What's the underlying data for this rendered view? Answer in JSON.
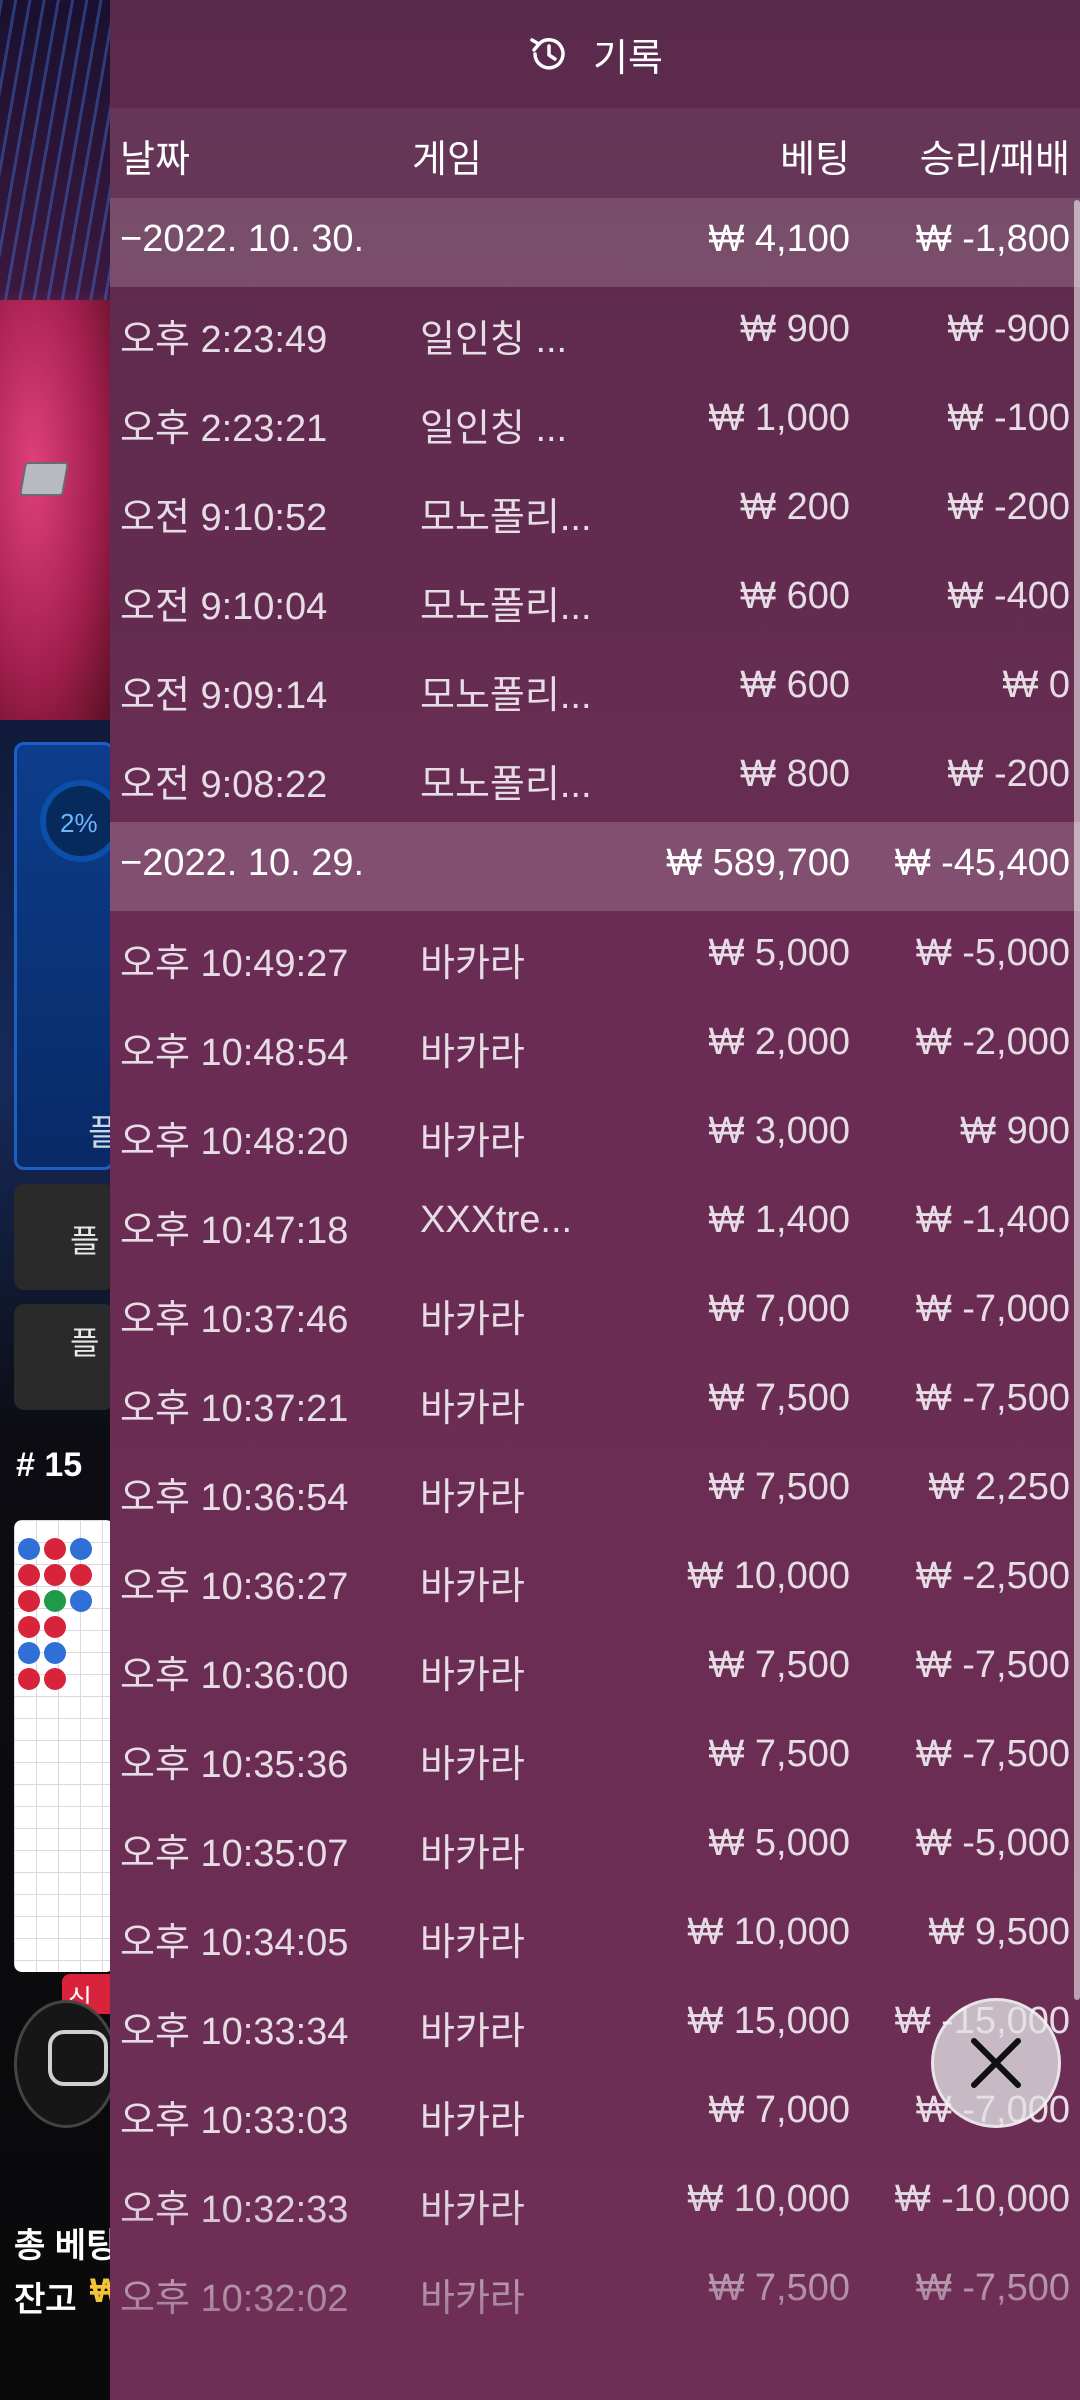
{
  "header": {
    "title": "기록",
    "icon": "history-clock-icon"
  },
  "columns": {
    "date": "날짜",
    "game": "게임",
    "bet": "베팅",
    "result": "승리/패배"
  },
  "groups": [
    {
      "date": "−2022. 10. 30.",
      "total_bet": "₩ 4,100",
      "total_result": "₩ -1,800",
      "rows": [
        {
          "time": "오후 2:23:49",
          "game": "일인칭 ...",
          "bet": "₩ 900",
          "result": "₩ -900"
        },
        {
          "time": "오후 2:23:21",
          "game": "일인칭 ...",
          "bet": "₩ 1,000",
          "result": "₩ -100"
        },
        {
          "time": "오전 9:10:52",
          "game": "모노폴리...",
          "bet": "₩ 200",
          "result": "₩ -200"
        },
        {
          "time": "오전 9:10:04",
          "game": "모노폴리...",
          "bet": "₩ 600",
          "result": "₩ -400"
        },
        {
          "time": "오전 9:09:14",
          "game": "모노폴리...",
          "bet": "₩ 600",
          "result": "₩ 0"
        },
        {
          "time": "오전 9:08:22",
          "game": "모노폴리...",
          "bet": "₩ 800",
          "result": "₩ -200"
        }
      ]
    },
    {
      "date": "−2022. 10. 29.",
      "total_bet": "₩ 589,700",
      "total_result": "₩ -45,400",
      "rows": [
        {
          "time": "오후 10:49:27",
          "game": "바카라",
          "bet": "₩ 5,000",
          "result": "₩ -5,000"
        },
        {
          "time": "오후 10:48:54",
          "game": "바카라",
          "bet": "₩ 2,000",
          "result": "₩ -2,000"
        },
        {
          "time": "오후 10:48:20",
          "game": "바카라",
          "bet": "₩ 3,000",
          "result": "₩ 900"
        },
        {
          "time": "오후 10:47:18",
          "game": "XXXtre...",
          "bet": "₩ 1,400",
          "result": "₩ -1,400"
        },
        {
          "time": "오후 10:37:46",
          "game": "바카라",
          "bet": "₩ 7,000",
          "result": "₩ -7,000"
        },
        {
          "time": "오후 10:37:21",
          "game": "바카라",
          "bet": "₩ 7,500",
          "result": "₩ -7,500"
        },
        {
          "time": "오후 10:36:54",
          "game": "바카라",
          "bet": "₩ 7,500",
          "result": "₩ 2,250"
        },
        {
          "time": "오후 10:36:27",
          "game": "바카라",
          "bet": "₩ 10,000",
          "result": "₩ -2,500"
        },
        {
          "time": "오후 10:36:00",
          "game": "바카라",
          "bet": "₩ 7,500",
          "result": "₩ -7,500"
        },
        {
          "time": "오후 10:35:36",
          "game": "바카라",
          "bet": "₩ 7,500",
          "result": "₩ -7,500"
        },
        {
          "time": "오후 10:35:07",
          "game": "바카라",
          "bet": "₩ 5,000",
          "result": "₩ -5,000"
        },
        {
          "time": "오후 10:34:05",
          "game": "바카라",
          "bet": "₩ 10,000",
          "result": "₩ 9,500"
        },
        {
          "time": "오후 10:33:34",
          "game": "바카라",
          "bet": "₩ 15,000",
          "result": "₩ -15,000"
        },
        {
          "time": "오후 10:33:03",
          "game": "바카라",
          "bet": "₩ 7,000",
          "result": "₩ -7,000"
        },
        {
          "time": "오후 10:32:33",
          "game": "바카라",
          "bet": "₩ 10,000",
          "result": "₩ -10,000"
        },
        {
          "time": "오후 10:32:02",
          "game": "바카라",
          "bet": "₩ 7,500",
          "result": "₩ -7,500"
        }
      ]
    }
  ],
  "background": {
    "progress_text": "2%",
    "side_label": "플",
    "side_btn_1": "플",
    "side_btn_2": "플",
    "round": "# 15",
    "new_badge": "신규",
    "total_bet_label": "총 베팅",
    "balance_label": "잔고",
    "balance_value": "₩"
  },
  "close": {
    "icon": "close-icon"
  }
}
